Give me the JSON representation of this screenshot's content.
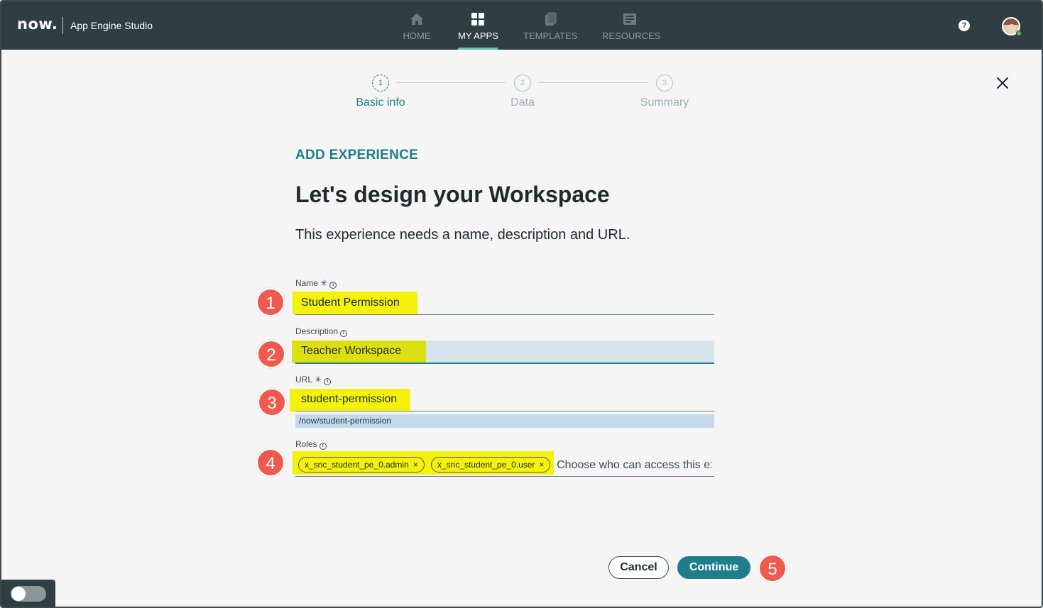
{
  "header": {
    "logo_text": "now.",
    "app_name": "App Engine Studio",
    "nav": [
      {
        "label": "HOME",
        "icon": "home-icon",
        "active": false
      },
      {
        "label": "MY APPS",
        "icon": "grid-icon",
        "active": true
      },
      {
        "label": "TEMPLATES",
        "icon": "templates-icon",
        "active": false
      },
      {
        "label": "RESOURCES",
        "icon": "resources-icon",
        "active": false
      }
    ],
    "help_icon": "?"
  },
  "stepper": {
    "steps": [
      {
        "number": "1",
        "label": "Basic info",
        "state": "active"
      },
      {
        "number": "2",
        "label": "Data",
        "state": "inactive"
      },
      {
        "number": "3",
        "label": "Summary",
        "state": "inactive"
      }
    ]
  },
  "content": {
    "eyebrow": "ADD EXPERIENCE",
    "title": "Let's design your Workspace",
    "subtitle": "This experience needs a name, description and URL."
  },
  "form": {
    "name": {
      "label": "Name",
      "required_mark": "✳",
      "value": "Student Permission"
    },
    "description": {
      "label": "Description",
      "value": "Teacher Workspace"
    },
    "url": {
      "label": "URL",
      "required_mark": "✳",
      "value": "student-permission",
      "preview": "/now/student-permission"
    },
    "roles": {
      "label": "Roles",
      "chips": [
        "x_snc_student_pe_0.admin",
        "x_snc_student_pe_0.user"
      ],
      "chip_remove": "×",
      "placeholder": "Choose who can access this experience"
    },
    "info_glyph": "i"
  },
  "annotations": [
    "1",
    "2",
    "3",
    "4",
    "5"
  ],
  "actions": {
    "cancel": "Cancel",
    "continue": "Continue"
  },
  "colors": {
    "header_bg": "#2f3e42",
    "accent": "#1f7d8c",
    "highlight": "#f4f20c",
    "badge": "#ef5a4f"
  }
}
